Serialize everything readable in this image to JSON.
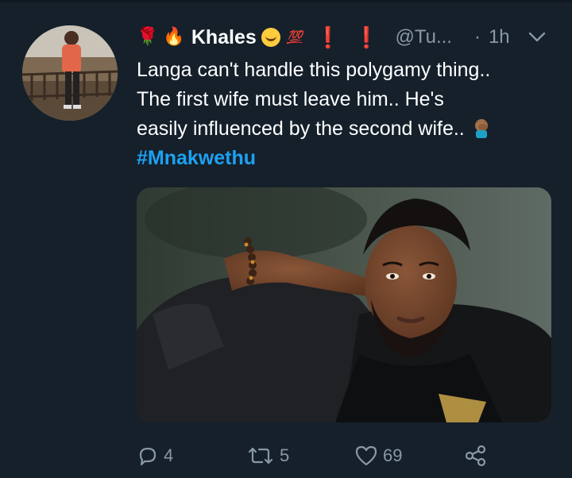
{
  "tweet": {
    "display_name": "Khales",
    "name_emojis": {
      "rose": "🌹",
      "fire": "🔥",
      "hundred": "💯",
      "exclaim_1": "❗",
      "exclaim_2": "❗"
    },
    "handle": "@Tu...",
    "separator": "·",
    "time": "1h",
    "text_lines": [
      "Langa can't handle this polygamy thing..",
      "The first wife must leave him.. He's",
      "easily influenced by the second wife.."
    ],
    "hashtag": "#Mnakwethu",
    "actions": {
      "reply_count": "4",
      "retweet_count": "5",
      "like_count": "69"
    }
  },
  "theme": {
    "background": "#15202b",
    "muted": "#8899a6",
    "link": "#1da1f2",
    "text": "#ffffff"
  },
  "icons": {
    "menu": "chevron-down-icon",
    "reply": "reply-icon",
    "retweet": "retweet-icon",
    "like": "heart-icon",
    "share": "share-icon",
    "emoji": "man-facepalming-icon"
  }
}
